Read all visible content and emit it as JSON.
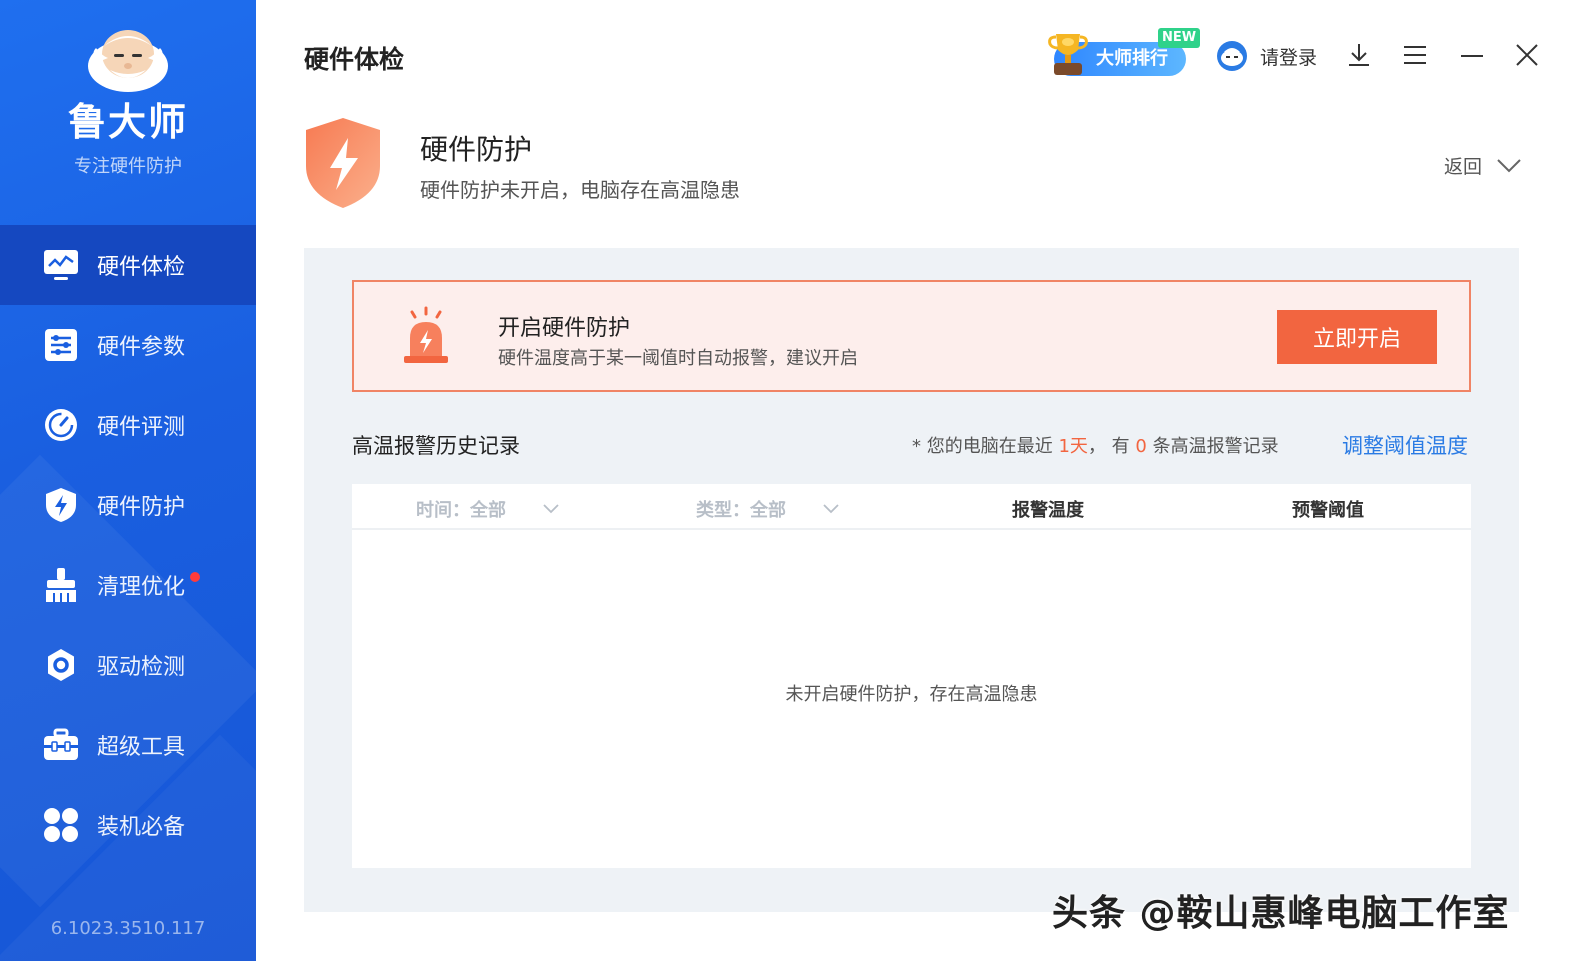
{
  "app": {
    "brand": "鲁大师",
    "slogan": "专注硬件防护",
    "version": "6.1023.3510.117"
  },
  "sidebar": {
    "items": [
      {
        "label": "硬件体检",
        "icon": "monitor-icon",
        "active": true
      },
      {
        "label": "硬件参数",
        "icon": "sliders-icon"
      },
      {
        "label": "硬件评测",
        "icon": "speedometer-icon"
      },
      {
        "label": "硬件防护",
        "icon": "shield-bolt-icon"
      },
      {
        "label": "清理优化",
        "icon": "broom-icon",
        "badge": true
      },
      {
        "label": "驱动检测",
        "icon": "gear-icon"
      },
      {
        "label": "超级工具",
        "icon": "toolbox-icon"
      },
      {
        "label": "装机必备",
        "icon": "grid-icon"
      }
    ]
  },
  "topbar": {
    "title": "硬件体检",
    "rank_label": "大师排行",
    "rank_new": "NEW",
    "login_label": "请登录"
  },
  "protection": {
    "title": "硬件防护",
    "subtitle": "硬件防护未开启，电脑存在高温隐患",
    "back_label": "返回"
  },
  "alert": {
    "title": "开启硬件防护",
    "subtitle": "硬件温度高于某一阈值时自动报警，建议开启",
    "button": "立即开启"
  },
  "history": {
    "title": "高温报警历史记录",
    "info_prefix": "* 您的电脑在最近",
    "info_days": "1天",
    "info_mid": "，  有",
    "info_count": "0",
    "info_suffix": "条高温报警记录",
    "adjust_link": "调整阈值温度",
    "columns": {
      "time": "时间：全部",
      "type": "类型：全部",
      "temp": "报警温度",
      "threshold": "预警阈值"
    },
    "empty_text": "未开启硬件防护，存在高温隐患"
  },
  "watermark": "头条 @鞍山惠峰电脑工作室",
  "colors": {
    "sidebar": "#1a5fe0",
    "sidebar_active": "#1548c0",
    "accent_orange": "#f26540",
    "link_blue": "#2a7be4",
    "panel_bg": "#eef2f6"
  }
}
